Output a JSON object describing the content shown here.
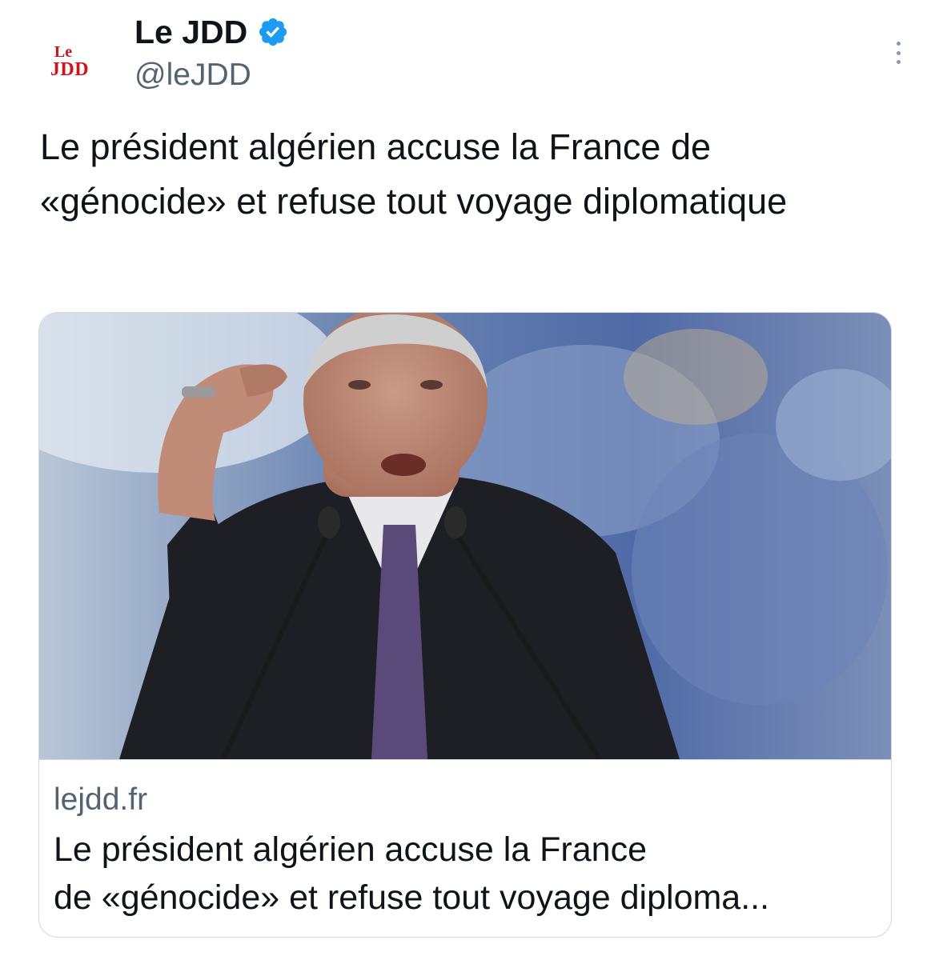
{
  "account": {
    "avatar_line1": "Le",
    "avatar_line2": "JDD",
    "name": "Le JDD",
    "handle": "@leJDD"
  },
  "tweet": {
    "text": "Le président algérien accuse la France de «génocide» et refuse tout voyage diplomatique"
  },
  "card": {
    "domain": "lejdd.fr",
    "title_line1": "Le président algérien accuse la France",
    "title_line2": "de «génocide» et refuse tout voyage diploma..."
  },
  "colors": {
    "text": "#0f1419",
    "secondary": "#536471",
    "verified": "#1d9bf0",
    "border": "#cfd9de",
    "logo_red": "#d0121b"
  },
  "icons": {
    "verified": "verified-badge-icon",
    "more": "more-dots-icon"
  }
}
